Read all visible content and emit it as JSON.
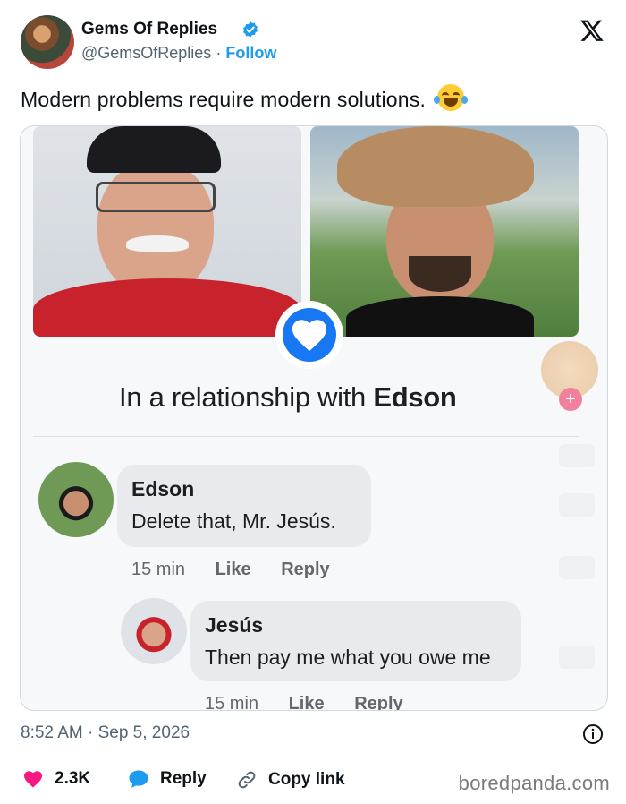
{
  "author": {
    "name": "Gems Of Replies",
    "handle": "@GemsOfReplies",
    "separator": "·",
    "follow_label": "Follow"
  },
  "tweet": {
    "text": "Modern problems require modern solutions."
  },
  "media": {
    "relationship_prefix": "In a relationship with",
    "relationship_name": "Edson",
    "side_plus": "+",
    "comments": [
      {
        "name": "Edson",
        "text": "Delete that, Mr. Jesús.",
        "time": "15 min",
        "like": "Like",
        "reply": "Reply"
      },
      {
        "name": "Jesús",
        "text": "Then pay me what you owe me",
        "time": "15 min",
        "like": "Like",
        "reply": "Reply"
      }
    ]
  },
  "footer": {
    "timestamp": "8:52 AM · Sep 5, 2026",
    "likes": "2.3K",
    "reply_label": "Reply",
    "copy_label": "Copy link",
    "watermark": "boredpanda.com"
  },
  "colors": {
    "accent": "#1d9bf0",
    "like": "#f91880",
    "facebook_blue": "#1877f2"
  }
}
